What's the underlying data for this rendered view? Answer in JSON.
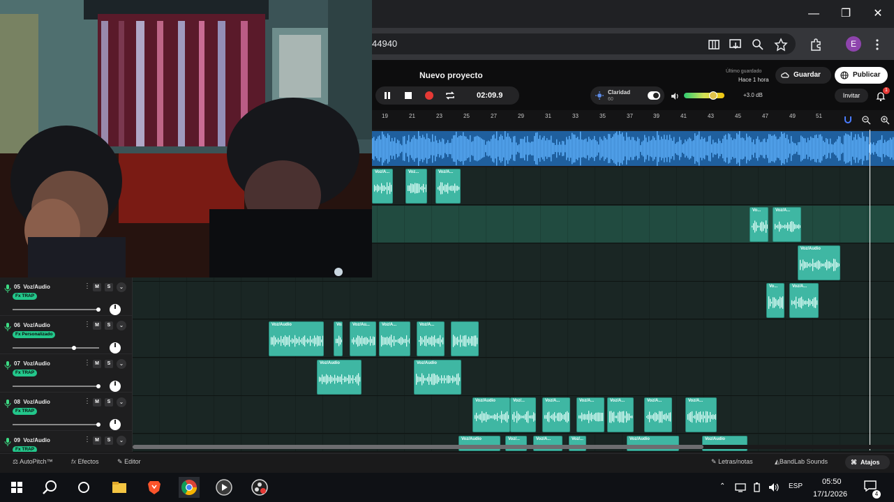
{
  "browser": {
    "url_fragment": "44940",
    "profile_initial": "E"
  },
  "project": {
    "title": "Nuevo proyecto",
    "time": "02:09.9",
    "clarity_label": "Claridad",
    "clarity_value": "60",
    "gain": "+3.0 dB",
    "saved_label": "Último guardado",
    "saved_time": "Hace 1 hora",
    "save_label": "Guardar",
    "publish_label": "Publicar",
    "invite_label": "Invitar",
    "notifications": "1",
    "volume_level": 0.72
  },
  "ruler": {
    "ticks": [
      "19",
      "21",
      "23",
      "25",
      "27",
      "29",
      "31",
      "33",
      "35",
      "37",
      "39",
      "41",
      "43",
      "45",
      "47",
      "49",
      "51"
    ]
  },
  "tracks": [
    {
      "number": "05",
      "name": "Voz/Audio",
      "fx": "Fx TRAP",
      "fader": 0.98
    },
    {
      "number": "06",
      "name": "Voz/Audio",
      "fx": "Fx Personalizado",
      "fader": 0.7
    },
    {
      "number": "07",
      "name": "Voz/Audio",
      "fx": "Fx TRAP",
      "fader": 0.98
    },
    {
      "number": "08",
      "name": "Voz/Audio",
      "fx": "Fx TRAP",
      "fader": 0.98
    },
    {
      "number": "09",
      "name": "Voz/Audio",
      "fx": "Fx TRAP",
      "fader": 0.98
    }
  ],
  "track_controls": {
    "mute": "M",
    "solo": "S"
  },
  "clips": {
    "lane1": [
      "Voz/A...",
      "Voz...",
      "Voz/A..."
    ],
    "lane2": [
      "Vo...",
      "Voz/A..."
    ],
    "lane3": [
      "Voz/Audio"
    ],
    "lane4": [
      "Vo...",
      "Voz/A..."
    ],
    "lane5": [
      "Voz/Audio",
      "Voz/A...",
      "Voz/Au...",
      "Voz/A...",
      "Voz/A..."
    ],
    "lane6": [
      "Voz/Audio",
      "Voz/Audio"
    ],
    "lane7": [
      "Voz/Audio",
      "Voz/...",
      "Voz/A...",
      "Voz/A...",
      "Voz/A...",
      "Voz/A...",
      "Voz/A..."
    ],
    "lane8": [
      "Voz/Audio",
      "Voz/...",
      "Voz/A...",
      "Voz/...",
      "Voz/Audio",
      "Voz/Audio"
    ]
  },
  "bottom_bar": {
    "autopitch": "AutoPitch™",
    "effects": "Efectos",
    "editor": "Editor",
    "lyrics": "Letras/notas",
    "sounds": "BandLab Sounds",
    "shortcuts": "Atajos"
  },
  "taskbar": {
    "language": "ESP",
    "time": "05:50",
    "date": "17/1/2026",
    "notifications": "4"
  },
  "colors": {
    "clip": "#3fb7a3",
    "master_wave": "#1f5f9e",
    "record": "#e53935",
    "fx_badge": "#23c78b"
  }
}
